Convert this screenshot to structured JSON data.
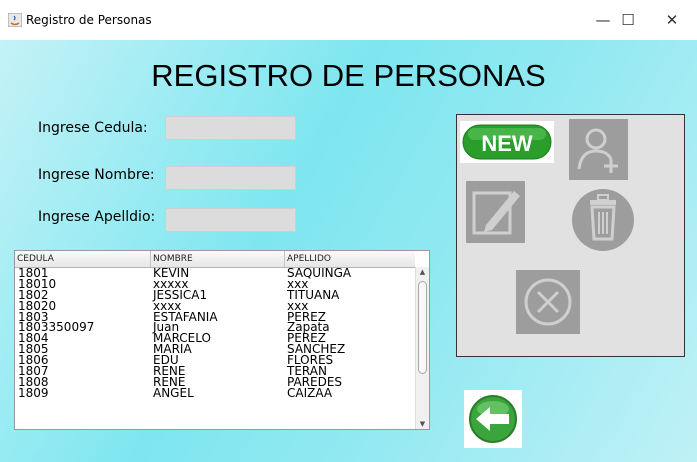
{
  "window": {
    "title": "Registro de Personas",
    "minimize": "—",
    "maximize": "☐",
    "close": "✕"
  },
  "page": {
    "title": "REGISTRO DE PERSONAS"
  },
  "form": {
    "cedula_label": "Ingrese Cedula:",
    "cedula_value": "",
    "nombre_label": "Ingrese Nombre:",
    "nombre_value": "",
    "apellido_label": "Ingrese Apelldio:",
    "apellido_value": ""
  },
  "table": {
    "columns": [
      "CEDULA",
      "NOMBRE",
      "APELLIDO"
    ],
    "rows": [
      [
        "1801",
        "KEVIN",
        "SAQUINGA"
      ],
      [
        "18010",
        "xxxxx",
        "xxx"
      ],
      [
        "1802",
        "JESSICA1",
        "TITUANA"
      ],
      [
        "18020",
        "xxxx",
        "xxx"
      ],
      [
        "1803",
        "ESTAFANIA",
        "PEREZ"
      ],
      [
        "1803350097",
        "Juan",
        "Zapata"
      ],
      [
        "1804",
        "MARCELO",
        "PEREZ"
      ],
      [
        "1805",
        "MARIA",
        "SANCHEZ"
      ],
      [
        "1806",
        "EDU",
        "FLORES"
      ],
      [
        "1807",
        "RENE",
        "TERAN"
      ],
      [
        "1808",
        "RENE",
        "PAREDES"
      ],
      [
        "1809",
        "ANGEL",
        "CAIZAA"
      ]
    ]
  },
  "buttons": {
    "new_label": "NEW"
  },
  "icons": {
    "new": "new-icon",
    "add_user": "add-user-icon",
    "edit": "edit-icon",
    "delete": "trash-icon",
    "cancel": "cancel-icon",
    "back": "back-arrow-icon"
  },
  "colors": {
    "background": "#8fe8f1",
    "panel": "#e1e1e1",
    "new_green": "#2a9d2a",
    "disabled_icon": "#9d9d9d"
  }
}
